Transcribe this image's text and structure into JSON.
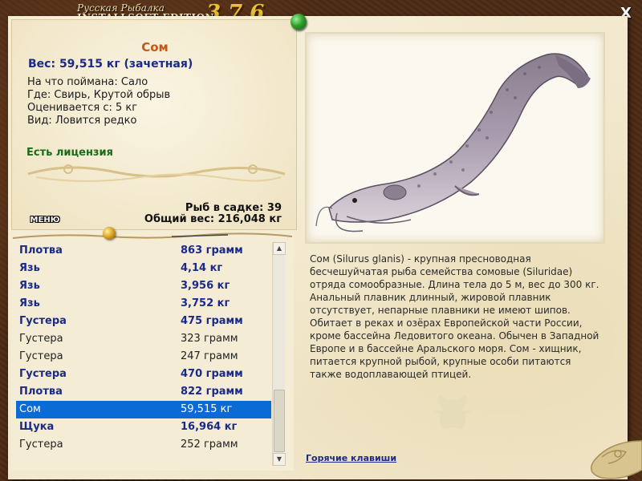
{
  "window": {
    "title_line1": "Русская Рыбалка",
    "title_line2": "INSTALLSOFT EDITION",
    "version": "3.7.6",
    "close_label": "X"
  },
  "fish_card": {
    "name": "Сом",
    "weight": "Вес: 59,515 кг (зачетная)",
    "bait": "На что поймана: Сало",
    "location": "Где: Свирь, Крутой обрыв",
    "min_weight": "Оценивается с: 5 кг",
    "rarity": "Вид: Ловится редко",
    "license": "Есть лицензия"
  },
  "menu_label": "МЕНЮ",
  "keepnet": {
    "count_text": "Рыб в садке: 39",
    "total_text": "Общий вес: 216,048 кг"
  },
  "catch_list": [
    {
      "name": "Плотва",
      "value": "863 грамм",
      "bold": true
    },
    {
      "name": "Язь",
      "value": "4,14 кг",
      "bold": true
    },
    {
      "name": "Язь",
      "value": "3,956 кг",
      "bold": true
    },
    {
      "name": "Язь",
      "value": "3,752 кг",
      "bold": true
    },
    {
      "name": "Густера",
      "value": "475 грамм",
      "bold": true
    },
    {
      "name": "Густера",
      "value": "323 грамм",
      "bold": false
    },
    {
      "name": "Густера",
      "value": "247 грамм",
      "bold": false
    },
    {
      "name": "Густера",
      "value": "470 грамм",
      "bold": true
    },
    {
      "name": "Плотва",
      "value": "822 грамм",
      "bold": true
    },
    {
      "name": "Сом",
      "value": "59,515 кг",
      "bold": true,
      "selected": true
    },
    {
      "name": "Щука",
      "value": "16,964 кг",
      "bold": true
    },
    {
      "name": "Густера",
      "value": "252 грамм",
      "bold": false
    }
  ],
  "description": "Сом (Silurus glanis) - крупная пресноводная бесчешуйчатая рыба семейства сомовые (Siluridae) отряда сомообразные. Длина тела до 5 м, вес до 300 кг. Анальный плавник длинный, жировой плавник отсутствует, непарные плавники не имеют шипов. Обитает в реках и озёрах Европейской части России, кроме бассейна Ледовитого океана. Обычен в Западной Европе и в бассейне Аральского моря. Сом - хищник, питается крупной рыбой, крупные особи питаются также водоплавающей птицей.",
  "hotkeys_label": "Горячие клавиши",
  "colors": {
    "selected_row": "#0a6ad6",
    "bold_row_text": "#1a2a88",
    "fish_name": "#c05a1a",
    "license": "#1a6a1a"
  }
}
